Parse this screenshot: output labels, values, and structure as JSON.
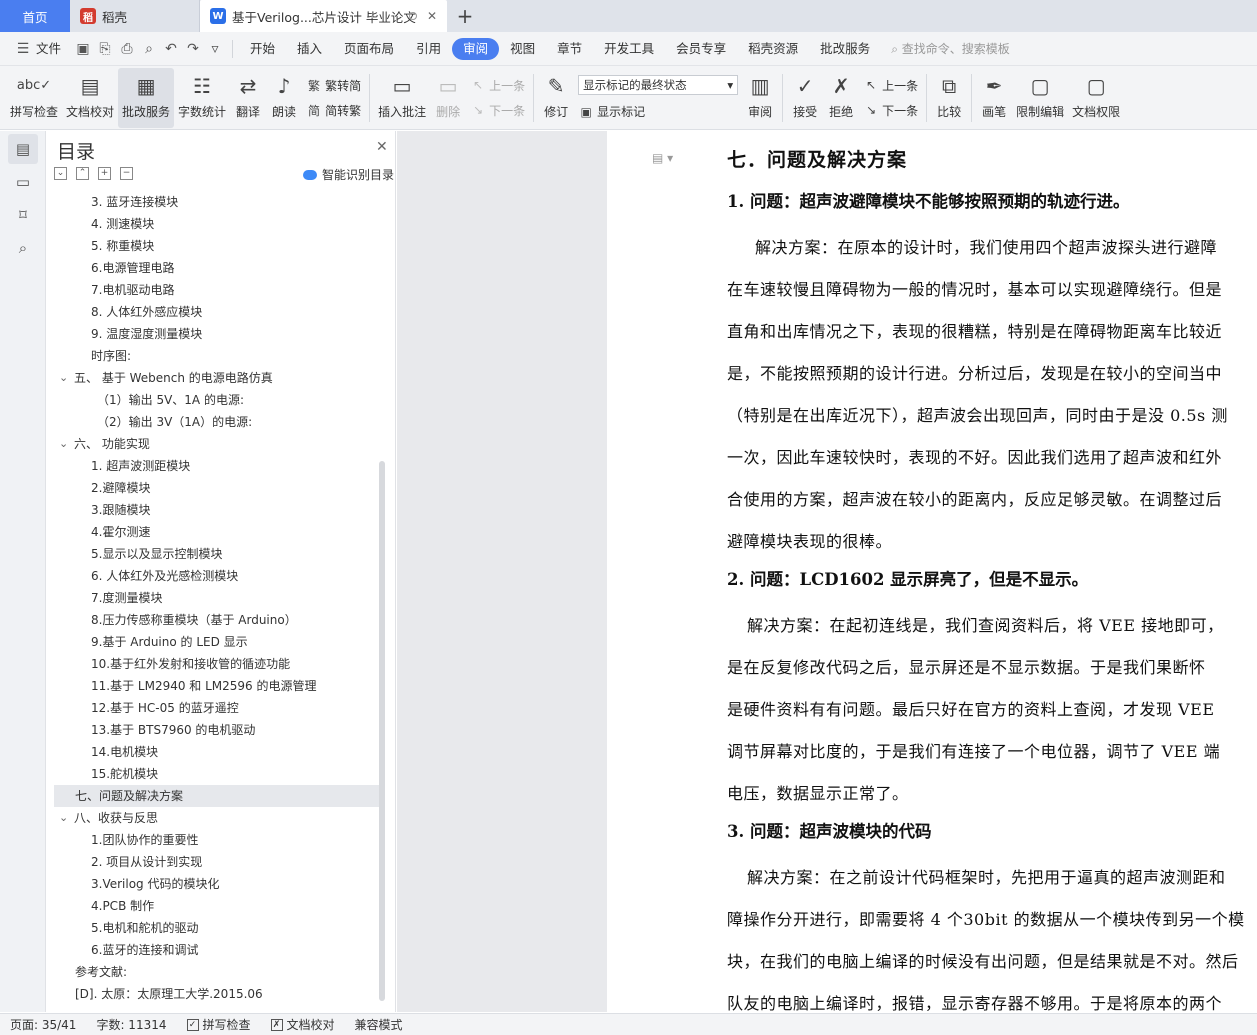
{
  "tabs": {
    "home": "首页",
    "doc1": "稻壳",
    "doc2": "基于Verilog...芯片设计 毕业论文",
    "plus": "+"
  },
  "menu": {
    "file": "文件",
    "items": [
      "开始",
      "插入",
      "页面布局",
      "引用",
      "审阅",
      "视图",
      "章节",
      "开发工具",
      "会员专享",
      "稻壳资源",
      "批改服务"
    ],
    "active_index": 4,
    "search": "查找命令、搜索模板"
  },
  "ribbon": {
    "spell": "拼写检查",
    "proofread": "文档校对",
    "review_service": "批改服务",
    "word_count": "字数统计",
    "translate": "翻译",
    "read_aloud": "朗读",
    "to_traditional": "繁转简",
    "to_simplified": "简转繁",
    "insert_comment": "插入批注",
    "delete": "删除",
    "prev": "上一条",
    "next": "下一条",
    "track": "修订",
    "markup_mode": "显示标记的最终状态",
    "show_markup": "显示标记",
    "review": "审阅",
    "accept": "接受",
    "reject": "拒绝",
    "prev2": "上一条",
    "next2": "下一条",
    "compare": "比较",
    "pen": "画笔",
    "restrict": "限制编辑",
    "permission": "文档权限"
  },
  "toc": {
    "title": "目录",
    "smart": "智能识别目录",
    "items": [
      {
        "text": "3. 蓝牙连接模块",
        "level": "l2"
      },
      {
        "text": "4. 测速模块",
        "level": "l2"
      },
      {
        "text": "5. 称重模块",
        "level": "l2"
      },
      {
        "text": "6.电源管理电路",
        "level": "l2"
      },
      {
        "text": "7.电机驱动电路",
        "level": "l2"
      },
      {
        "text": "8. 人体红外感应模块",
        "level": "l2"
      },
      {
        "text": "9. 温度湿度测量模块",
        "level": "l2"
      },
      {
        "text": "时序图:",
        "level": "l2"
      },
      {
        "text": "五、 基于 Webench 的电源电路仿真",
        "level": "l1"
      },
      {
        "text": "（1）输出 5V、1A 的电源:",
        "level": "l3"
      },
      {
        "text": "（2）输出 3V（1A）的电源:",
        "level": "l3"
      },
      {
        "text": "六、 功能实现",
        "level": "l1"
      },
      {
        "text": "1. 超声波测距模块",
        "level": "l2"
      },
      {
        "text": "2.避障模块",
        "level": "l2"
      },
      {
        "text": "3.跟随模块",
        "level": "l2"
      },
      {
        "text": "4.霍尔测速",
        "level": "l2"
      },
      {
        "text": "5.显示以及显示控制模块",
        "level": "l2"
      },
      {
        "text": "6. 人体红外及光感检测模块",
        "level": "l2"
      },
      {
        "text": "7.度测量模块",
        "level": "l2"
      },
      {
        "text": "8.压力传感称重模块（基于 Arduino）",
        "level": "l2"
      },
      {
        "text": "9.基于 Arduino 的 LED 显示",
        "level": "l2"
      },
      {
        "text": "10.基于红外发射和接收管的循迹功能",
        "level": "l2"
      },
      {
        "text": "11.基于 LM2940 和 LM2596 的电源管理",
        "level": "l2"
      },
      {
        "text": "12.基于 HC-05 的蓝牙遥控",
        "level": "l2"
      },
      {
        "text": "13.基于 BTS7960 的电机驱动",
        "level": "l2"
      },
      {
        "text": "14.电机模块",
        "level": "l2"
      },
      {
        "text": "15.舵机模块",
        "level": "l2"
      },
      {
        "text": "七、问题及解决方案",
        "level": "sel"
      },
      {
        "text": "八、收获与反思",
        "level": "l1"
      },
      {
        "text": "1.团队协作的重要性",
        "level": "l2"
      },
      {
        "text": "2. 项目从设计到实现",
        "level": "l2"
      },
      {
        "text": "3.Verilog 代码的模块化",
        "level": "l2"
      },
      {
        "text": "4.PCB 制作",
        "level": "l2"
      },
      {
        "text": "5.电机和舵机的驱动",
        "level": "l2"
      },
      {
        "text": "6.蓝牙的连接和调试",
        "level": "l2"
      },
      {
        "text": "参考文献:",
        "level": "l1x"
      },
      {
        "text": "[D]. 太原：太原理工大学.2015.06",
        "level": "l1x"
      }
    ]
  },
  "document": {
    "lines": [
      {
        "cls": "h1",
        "text": "七．问题及解决方案"
      },
      {
        "cls": "h2",
        "text": "1. 问题：超声波避障模块不能够按照预期的轨迹行进。"
      },
      {
        "cls": "p ind1",
        "text": "解决方案：在原本的设计时，我们使用四个超声波探头进行避障"
      },
      {
        "cls": "p",
        "text": "在车速较慢且障碍物为一般的情况时，基本可以实现避障绕行。但是"
      },
      {
        "cls": "p",
        "text": "直角和出库情况之下，表现的很糟糕，特别是在障碍物距离车比较近"
      },
      {
        "cls": "p",
        "text": "是，不能按照预期的设计行进。分析过后，发现是在较小的空间当中"
      },
      {
        "cls": "p",
        "text": "（特别是在出库近况下），超声波会出现回声，同时由于是没 0.5s 测"
      },
      {
        "cls": "p",
        "text": "一次，因此车速较快时，表现的不好。因此我们选用了超声波和红外"
      },
      {
        "cls": "p",
        "text": "合使用的方案，超声波在较小的距离内，反应足够灵敏。在调整过后"
      },
      {
        "cls": "p",
        "text": "避障模块表现的很棒。"
      },
      {
        "cls": "h2",
        "text": "2. 问题：LCD1602 显示屏亮了，但是不显示。"
      },
      {
        "cls": "p ind2",
        "text": "解决方案：在起初连线是，我们查阅资料后，将 VEE 接地即可，"
      },
      {
        "cls": "p",
        "text": "是在反复修改代码之后，显示屏还是不显示数据。于是我们果断怀"
      },
      {
        "cls": "p",
        "text": "是硬件资料有有问题。最后只好在官方的资料上查阅，才发现 VEE"
      },
      {
        "cls": "p",
        "text": "调节屏幕对比度的，于是我们有连接了一个电位器，调节了 VEE 端"
      },
      {
        "cls": "p",
        "text": "电压，数据显示正常了。"
      },
      {
        "cls": "h2",
        "text": "3. 问题：超声波模块的代码"
      },
      {
        "cls": "p ind2",
        "text": "解决方案：在之前设计代码框架时，先把用于逼真的超声波测距和"
      },
      {
        "cls": "p",
        "text": "障操作分开进行，即需要将 4 个30bit 的数据从一个模块传到另一个模"
      },
      {
        "cls": "p",
        "text": "块，在我们的电脑上编译的时候没有出问题，但是结果就是不对。然后"
      },
      {
        "cls": "p",
        "text": "队友的电脑上编译时，报错，显示寄存器不够用。于是将原本的两个"
      }
    ]
  },
  "status": {
    "page": "页面: 35/41",
    "words": "字数: 11314",
    "spell": "拼写检查",
    "proof": "文档校对",
    "compat": "兼容模式"
  }
}
